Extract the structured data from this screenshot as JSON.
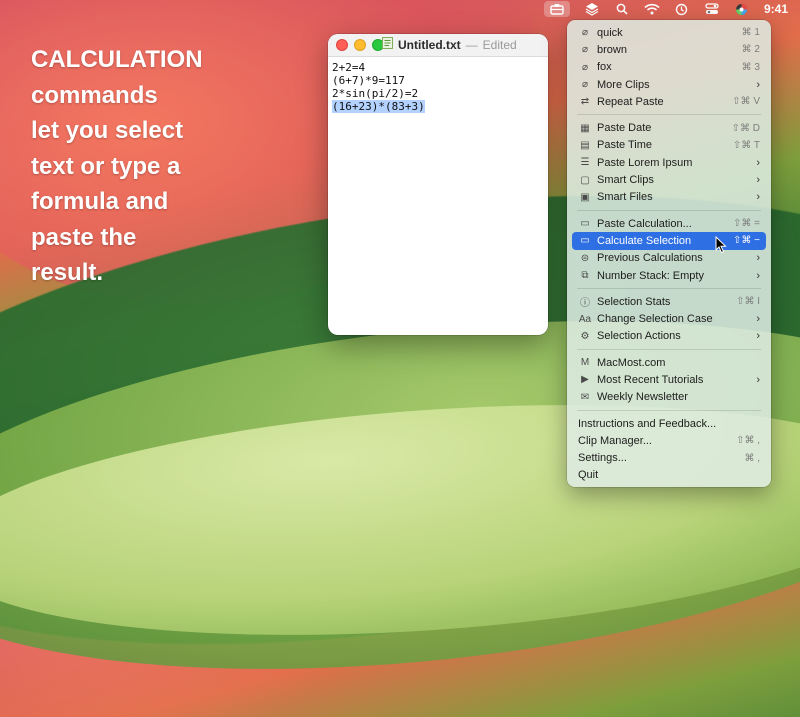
{
  "menubar": {
    "time": "9:41",
    "icons": [
      "clipboard-icon",
      "layers-icon",
      "search-icon",
      "wifi-icon",
      "history-icon",
      "control-center-icon",
      "color-wheel-icon"
    ]
  },
  "hero": {
    "text": "CALCULATION\ncommands\nlet you select\ntext or type a\nformula and\npaste the\nresult."
  },
  "document": {
    "title": "Untitled.txt",
    "separator": "—",
    "status": "Edited",
    "lines": [
      "2+2=4",
      "(6+7)*9=117",
      "2*sin(pi/2)=2",
      "(16+23)*(83+3)"
    ]
  },
  "menu": {
    "sections": [
      [
        {
          "icon": "paperclip-icon",
          "glyph": "⌀",
          "label": "quick",
          "shortcut": "⌘ 1",
          "submenu": false
        },
        {
          "icon": "paperclip-icon",
          "glyph": "⌀",
          "label": "brown",
          "shortcut": "⌘ 2",
          "submenu": false
        },
        {
          "icon": "paperclip-icon",
          "glyph": "⌀",
          "label": "fox",
          "shortcut": "⌘ 3",
          "submenu": false
        },
        {
          "icon": "paperclip-icon",
          "glyph": "⌀",
          "label": "More Clips",
          "shortcut": "",
          "submenu": true
        },
        {
          "icon": "repeat-icon",
          "glyph": "⇄",
          "label": "Repeat Paste",
          "shortcut": "⇧⌘ V",
          "submenu": false
        }
      ],
      [
        {
          "icon": "calendar-icon",
          "glyph": "▦",
          "label": "Paste Date",
          "shortcut": "⇧⌘ D",
          "submenu": false
        },
        {
          "icon": "clock-calendar-icon",
          "glyph": "▤",
          "label": "Paste Time",
          "shortcut": "⇧⌘ T",
          "submenu": false
        },
        {
          "icon": "text-lines-icon",
          "glyph": "☰",
          "label": "Paste Lorem Ipsum",
          "shortcut": "",
          "submenu": true
        },
        {
          "icon": "smart-clips-icon",
          "glyph": "▢",
          "label": "Smart Clips",
          "shortcut": "",
          "submenu": true
        },
        {
          "icon": "smart-files-icon",
          "glyph": "▣",
          "label": "Smart Files",
          "shortcut": "",
          "submenu": true
        }
      ],
      [
        {
          "icon": "calculator-icon",
          "glyph": "▭",
          "label": "Paste Calculation...",
          "shortcut": "⇧⌘ =",
          "submenu": false
        },
        {
          "icon": "calculator-icon",
          "glyph": "▭",
          "label": "Calculate Selection",
          "shortcut": "⇧⌘ −",
          "submenu": false,
          "highlighted": true
        },
        {
          "icon": "equals-circle-icon",
          "glyph": "⊜",
          "label": "Previous Calculations",
          "shortcut": "",
          "submenu": true
        },
        {
          "icon": "stack-icon",
          "glyph": "⧉",
          "label": "Number Stack: Empty",
          "shortcut": "",
          "submenu": true
        }
      ],
      [
        {
          "icon": "info-box-icon",
          "glyph": "ⓘ",
          "label": "Selection Stats",
          "shortcut": "⇧⌘ I",
          "submenu": false
        },
        {
          "icon": "text-case-icon",
          "glyph": "Aa",
          "label": "Change Selection Case",
          "shortcut": "",
          "submenu": true
        },
        {
          "icon": "gear-icon",
          "glyph": "⚙",
          "label": "Selection Actions",
          "shortcut": "",
          "submenu": true
        }
      ],
      [
        {
          "icon": "macmost-logo-icon",
          "glyph": "M",
          "label": "MacMost.com",
          "shortcut": "",
          "submenu": false
        },
        {
          "icon": "play-box-icon",
          "glyph": "▶",
          "label": "Most Recent Tutorials",
          "shortcut": "",
          "submenu": true
        },
        {
          "icon": "newsletter-icon",
          "glyph": "✉",
          "label": "Weekly Newsletter",
          "shortcut": "",
          "submenu": false
        }
      ],
      [
        {
          "icon": "",
          "glyph": "",
          "label": "Instructions and Feedback...",
          "shortcut": "",
          "submenu": false
        },
        {
          "icon": "",
          "glyph": "",
          "label": "Clip Manager...",
          "shortcut": "⇧⌘ ,",
          "submenu": false
        },
        {
          "icon": "",
          "glyph": "",
          "label": "Settings...",
          "shortcut": "⌘ ,",
          "submenu": false
        },
        {
          "icon": "",
          "glyph": "",
          "label": "Quit",
          "shortcut": "",
          "submenu": false
        }
      ]
    ]
  },
  "colors": {
    "highlight": "#2f6fe4",
    "selection": "#b3d2ff"
  }
}
